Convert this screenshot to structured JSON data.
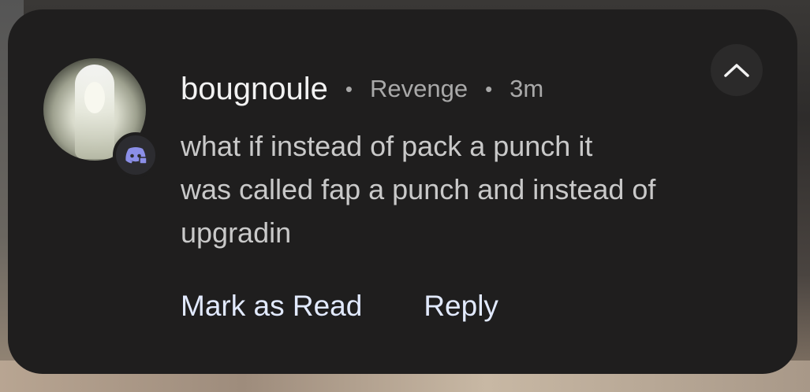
{
  "notification": {
    "sender": "bougnoule",
    "separator": "•",
    "server": "Revenge",
    "time": "3m",
    "message_lines": [
      "what if instead of pack a punch it",
      "was called fap a punch and instead of",
      "upgradin"
    ],
    "app_icon": "discord-icon",
    "collapse_icon": "chevron-up-icon"
  },
  "actions": {
    "mark_read_label": "Mark as Read",
    "reply_label": "Reply"
  },
  "colors": {
    "card_background": "#1f1e1e",
    "action_text": "#e2eaff",
    "discord_brand": "#8b8fe8"
  }
}
